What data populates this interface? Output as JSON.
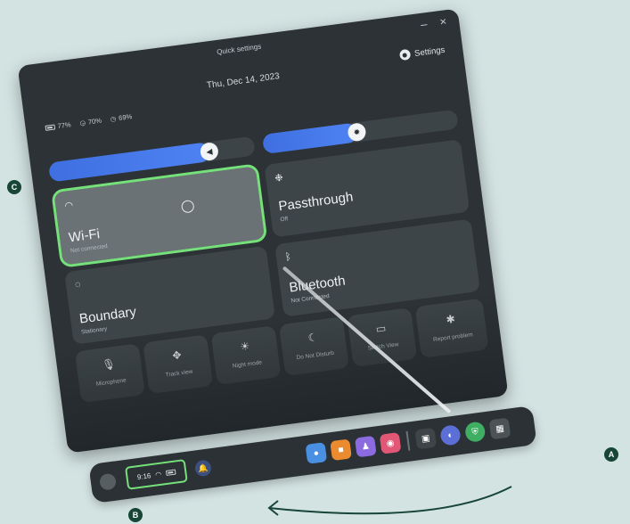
{
  "window": {
    "title": "Quick settings",
    "minimize": "–",
    "close": "×",
    "date": "Thu, Dec 14, 2023",
    "settings_label": "Settings"
  },
  "status": {
    "battery": "77%",
    "controller1": "70%",
    "controller2": "69%"
  },
  "sliders": {
    "volume_level": 0.78,
    "brightness_level": 0.48
  },
  "tiles": {
    "wifi": {
      "label": "Wi-Fi",
      "sub": "Not connected"
    },
    "passthrough": {
      "label": "Passthrough",
      "sub": "Off"
    },
    "boundary": {
      "label": "Boundary",
      "sub": "Stationary"
    },
    "bluetooth": {
      "label": "Bluetooth",
      "sub": "Not Connected"
    }
  },
  "small_tiles": [
    {
      "label": "Microphone",
      "icon": "microphone-icon"
    },
    {
      "label": "Track view",
      "icon": "move-icon"
    },
    {
      "label": "Night mode",
      "icon": "sun-icon"
    },
    {
      "label": "Do Not Disturb",
      "icon": "moon-icon"
    },
    {
      "label": "Switch View",
      "icon": "screen-icon"
    },
    {
      "label": "Report problem",
      "icon": "bug-icon"
    }
  ],
  "taskbar": {
    "time": "9:16",
    "apps": [
      "browser-app",
      "store-app",
      "people-app",
      "camera-app",
      "gallery-app",
      "avatar-app",
      "shield-app",
      "apps-grid"
    ]
  },
  "markers": {
    "a": "A",
    "b": "B",
    "c": "C"
  },
  "colors": {
    "highlight": "#76e07a",
    "accent": "#4e82f2",
    "marker": "#174536",
    "background": "#d3e3e2"
  }
}
